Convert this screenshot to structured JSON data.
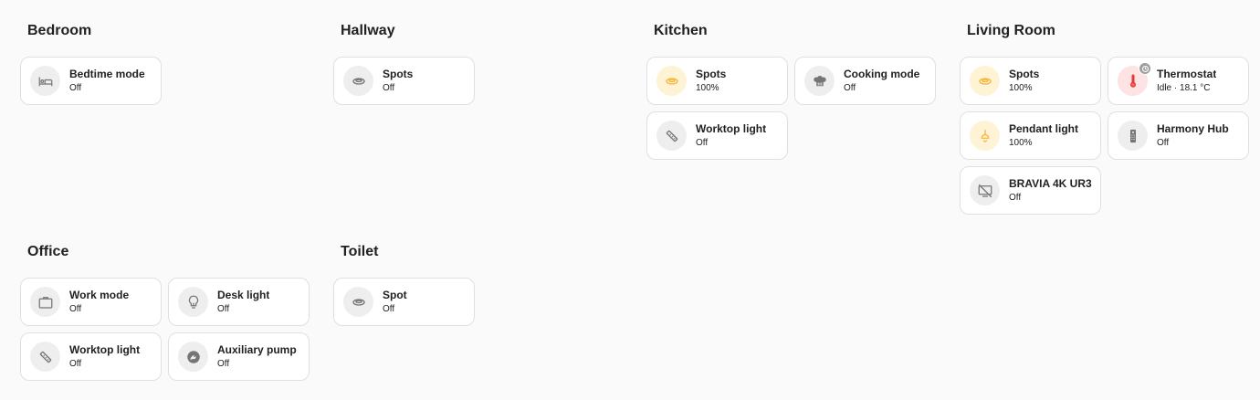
{
  "areas": [
    {
      "title": "Bedroom",
      "tiles": [
        {
          "name": "Bedtime mode",
          "state": "Off",
          "icon": "bed-icon",
          "active": "off"
        }
      ]
    },
    {
      "title": "Hallway",
      "tiles": [
        {
          "name": "Spots",
          "state": "Off",
          "icon": "ceiling-light-icon",
          "active": "off"
        }
      ]
    },
    {
      "title": "Kitchen",
      "tiles": [
        {
          "name": "Spots",
          "state": "100%",
          "icon": "ceiling-light-icon",
          "active": "on"
        },
        {
          "name": "Cooking mode",
          "state": "Off",
          "icon": "chef-hat-icon",
          "active": "off"
        },
        {
          "name": "Worktop light",
          "state": "Off",
          "icon": "light-strip-icon",
          "active": "off"
        }
      ]
    },
    {
      "title": "Living Room",
      "tiles": [
        {
          "name": "Spots",
          "state": "100%",
          "icon": "ceiling-light-icon",
          "active": "on"
        },
        {
          "name": "Thermostat",
          "state": "Idle · 18.1 °C",
          "icon": "thermometer-icon",
          "active": "hot",
          "badge": "clock-badge-icon"
        },
        {
          "name": "Pendant light",
          "state": "100%",
          "icon": "pendant-light-icon",
          "active": "on"
        },
        {
          "name": "Harmony Hub",
          "state": "Off",
          "icon": "remote-icon",
          "active": "off"
        },
        {
          "name": "BRAVIA 4K UR3",
          "state": "Off",
          "icon": "tv-off-icon",
          "active": "off"
        }
      ]
    },
    {
      "title": "Office",
      "tiles": [
        {
          "name": "Work mode",
          "state": "Off",
          "icon": "briefcase-icon",
          "active": "off"
        },
        {
          "name": "Desk light",
          "state": "Off",
          "icon": "lightbulb-icon",
          "active": "off"
        },
        {
          "name": "Worktop light",
          "state": "Off",
          "icon": "light-strip-icon",
          "active": "off"
        },
        {
          "name": "Auxiliary pump",
          "state": "Off",
          "icon": "pump-icon",
          "active": "off"
        }
      ]
    },
    {
      "title": "Toilet",
      "tiles": [
        {
          "name": "Spot",
          "state": "Off",
          "icon": "ceiling-light-icon",
          "active": "off"
        }
      ]
    }
  ],
  "colors": {
    "background": "#fafafa",
    "tile": "#ffffff",
    "tile_border": "#e0e0e0",
    "icon_off_bg": "#eeeeee",
    "icon_off": "#757575",
    "light_on_bg": "#fff3d6",
    "light_on": "#f4b73c",
    "heat_bg": "#fde3e3",
    "heat": "#e53935"
  }
}
